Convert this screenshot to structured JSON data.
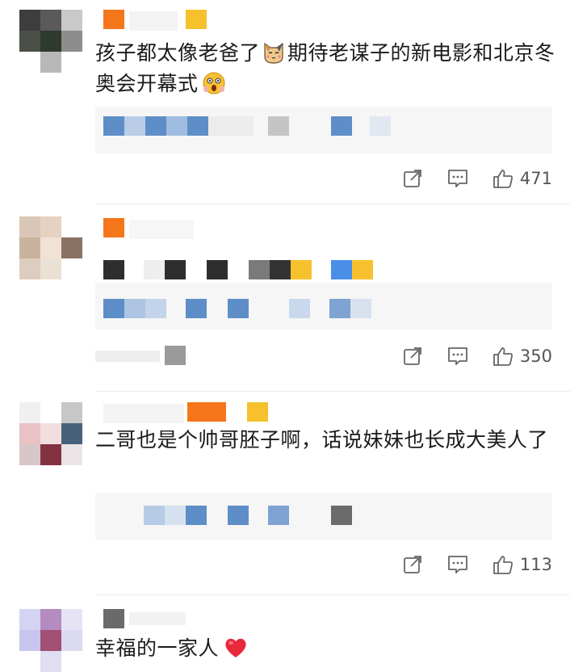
{
  "comments": [
    {
      "text": "孩子都太像老爸了",
      "text_after_cat": "期待老谋子的新电影和北京冬奥会开幕式",
      "likes": "471"
    },
    {
      "likes": "350"
    },
    {
      "text": "二哥也是个帅哥胚子啊，话说妹妹也长成大美人了",
      "likes": "113"
    },
    {
      "text": "幸福的一家人"
    }
  ],
  "icons": {
    "share": "share-icon",
    "comment": "comment-icon",
    "like": "thumbs-up-icon",
    "cat": "cat-emoji-icon",
    "wow": "surprised-face-emoji-icon",
    "heart": "red-heart-emoji-icon"
  },
  "colors": {
    "accent_orange": "#f5761b",
    "accent_yellow": "#f7c12d",
    "link_blue": "#5e8ec7",
    "heart_red": "#e8283b"
  }
}
